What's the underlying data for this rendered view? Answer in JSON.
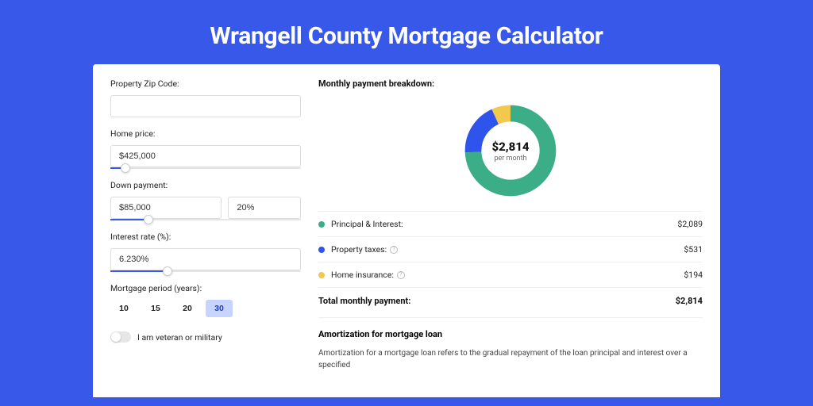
{
  "hero": {
    "title": "Wrangell County Mortgage Calculator"
  },
  "form": {
    "zip": {
      "label": "Property Zip Code:",
      "value": ""
    },
    "price": {
      "label": "Home price:",
      "value": "$425,000",
      "slider_pct": 8
    },
    "down": {
      "label": "Down payment:",
      "amount": "$85,000",
      "pct": "20%",
      "slider_pct": 20
    },
    "rate": {
      "label": "Interest rate (%):",
      "value": "6.230%",
      "slider_pct": 30
    },
    "period": {
      "label": "Mortgage period (years):",
      "options": [
        "10",
        "15",
        "20",
        "30"
      ],
      "selected": "30"
    },
    "veteran_label": "I am veteran or military"
  },
  "breakdown": {
    "title": "Monthly payment breakdown:",
    "center_value": "$2,814",
    "center_sub": "per month",
    "items": [
      {
        "label": "Principal & Interest:",
        "value": "$2,089",
        "color": "#3cae87"
      },
      {
        "label": "Property taxes:",
        "value": "$531",
        "color": "#2f54eb",
        "info": true
      },
      {
        "label": "Home insurance:",
        "value": "$194",
        "color": "#f2c94c",
        "info": true
      }
    ],
    "total_label": "Total monthly payment:",
    "total_value": "$2,814"
  },
  "amort": {
    "title": "Amortization for mortgage loan",
    "text": "Amortization for a mortgage loan refers to the gradual repayment of the loan principal and interest over a specified"
  },
  "chart_data": {
    "type": "pie",
    "title": "Monthly payment breakdown",
    "series": [
      {
        "name": "Principal & Interest",
        "value": 2089,
        "color": "#3cae87"
      },
      {
        "name": "Property taxes",
        "value": 531,
        "color": "#2f54eb"
      },
      {
        "name": "Home insurance",
        "value": 194,
        "color": "#f2c94c"
      }
    ],
    "total": 2814,
    "center_label": "$2,814 per month"
  }
}
